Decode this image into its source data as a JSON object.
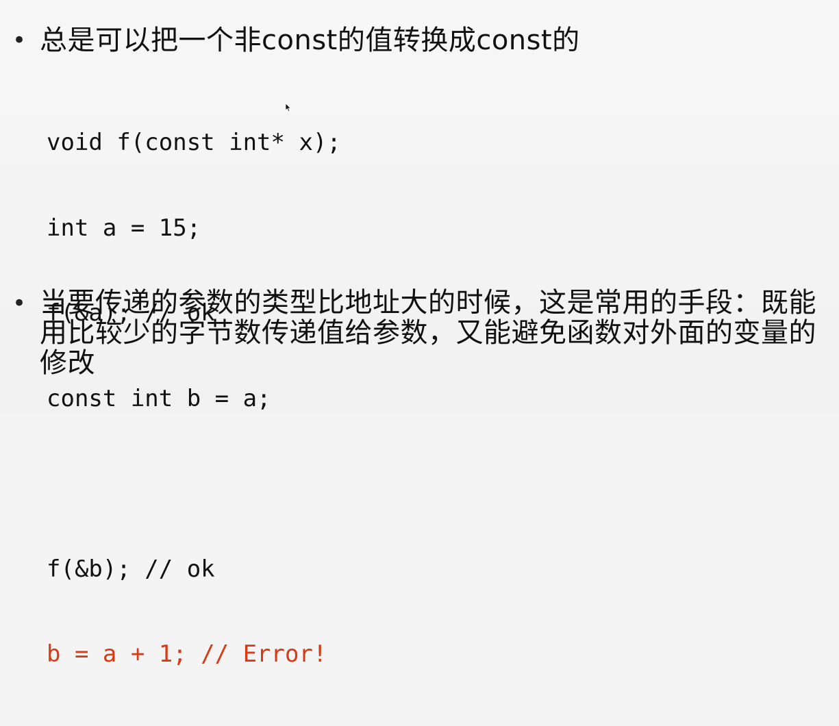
{
  "slide": {
    "bullet1": {
      "marker": "•",
      "text": "总是可以把一个非const的值转换成const的"
    },
    "code": [
      {
        "text": "void f(const int* x);",
        "style": "normal"
      },
      {
        "text": "int a = 15;",
        "style": "normal"
      },
      {
        "text": "f(&a); // ok",
        "style": "normal"
      },
      {
        "text": "const int b = a;",
        "style": "normal"
      },
      {
        "text": "",
        "style": "normal"
      },
      {
        "text": "f(&b); // ok",
        "style": "normal"
      },
      {
        "text": "b = a + 1; // Error!",
        "style": "error"
      }
    ],
    "bullet2": {
      "marker": "•",
      "text": "当要传递的参数的类型比地址大的时候，这是常用的手段：既能用比较少的字节数传递值给参数，又能避免函数对外面的变量的修改"
    }
  },
  "colors": {
    "background": "#f4f4f4",
    "text": "#111111",
    "error": "#d63b17"
  },
  "icons": {
    "cursor": "mouse-pointer-icon"
  }
}
